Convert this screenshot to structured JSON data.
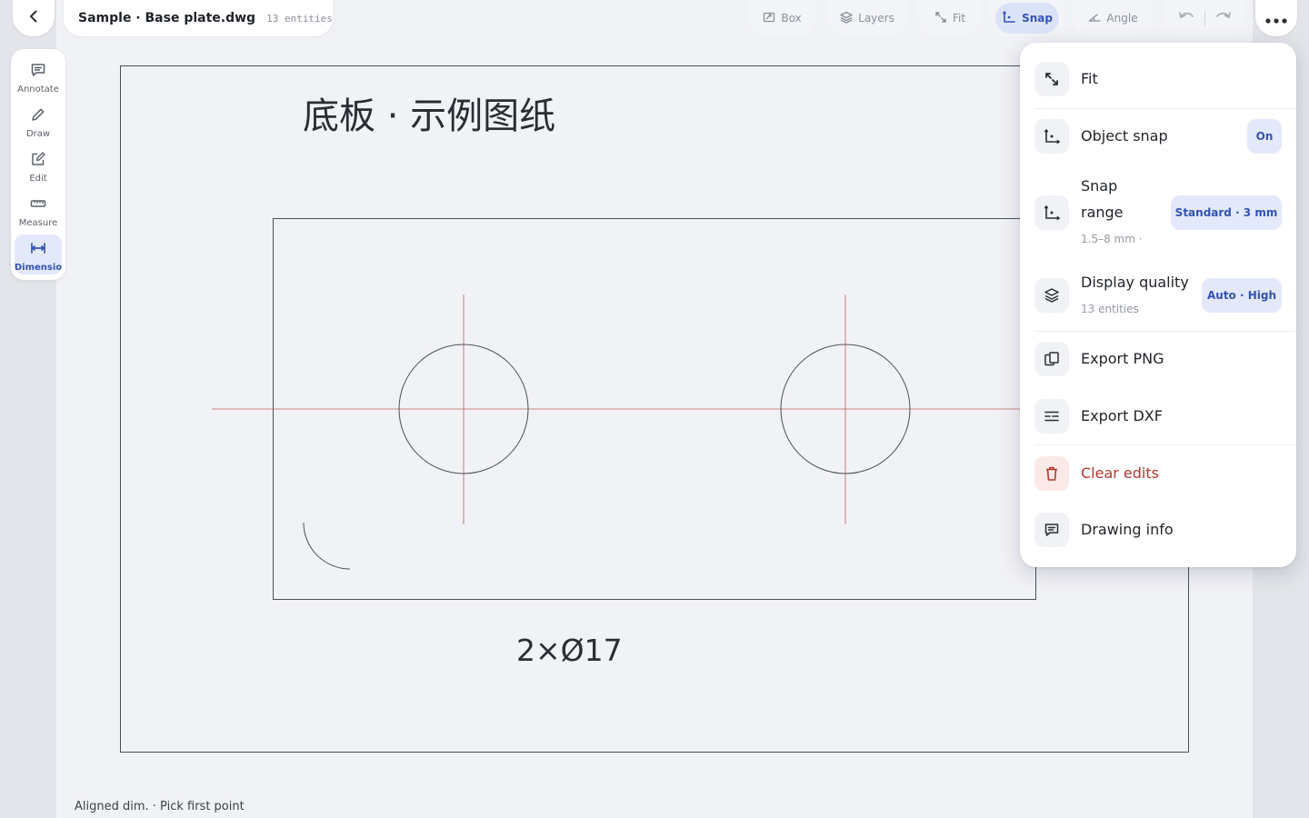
{
  "header": {
    "title": "Sample · Base plate.dwg",
    "entity_count": "13 entities",
    "toolbar": {
      "box": "Box",
      "layers": "Layers",
      "fit": "Fit",
      "snap": "Snap",
      "angle": "Angle"
    }
  },
  "tools": [
    {
      "label": "Annotate",
      "icon": "comment-icon"
    },
    {
      "label": "Draw",
      "icon": "pencil-icon"
    },
    {
      "label": "Edit",
      "icon": "edit-icon"
    },
    {
      "label": "Measure",
      "icon": "ruler-icon"
    },
    {
      "label": "Dimensio",
      "icon": "dimension-icon",
      "active": true
    }
  ],
  "drawing": {
    "title": "底板 · 示例图纸",
    "dimension_text": "2×Ø17"
  },
  "status": "Aligned dim. · Pick first point",
  "menu": {
    "fit": "Fit",
    "object_snap": "Object snap",
    "object_snap_state": "On",
    "snap_range_line1": "Snap",
    "snap_range_line2": "range",
    "snap_range_sub": "1.5–8 mm ·",
    "snap_range_value": "Standard · 3 mm",
    "display_quality": "Display quality",
    "display_quality_sub": "13 entities",
    "display_quality_value": "Auto · High",
    "export_png": "Export PNG",
    "export_dxf": "Export DXF",
    "clear_edits": "Clear edits",
    "drawing_info": "Drawing info"
  },
  "colors": {
    "accent": "#3253b4",
    "accent_bg": "#e3e9fb",
    "danger": "#b3372f",
    "centerline": "#c0605a",
    "geometry": "#4a4f58"
  }
}
